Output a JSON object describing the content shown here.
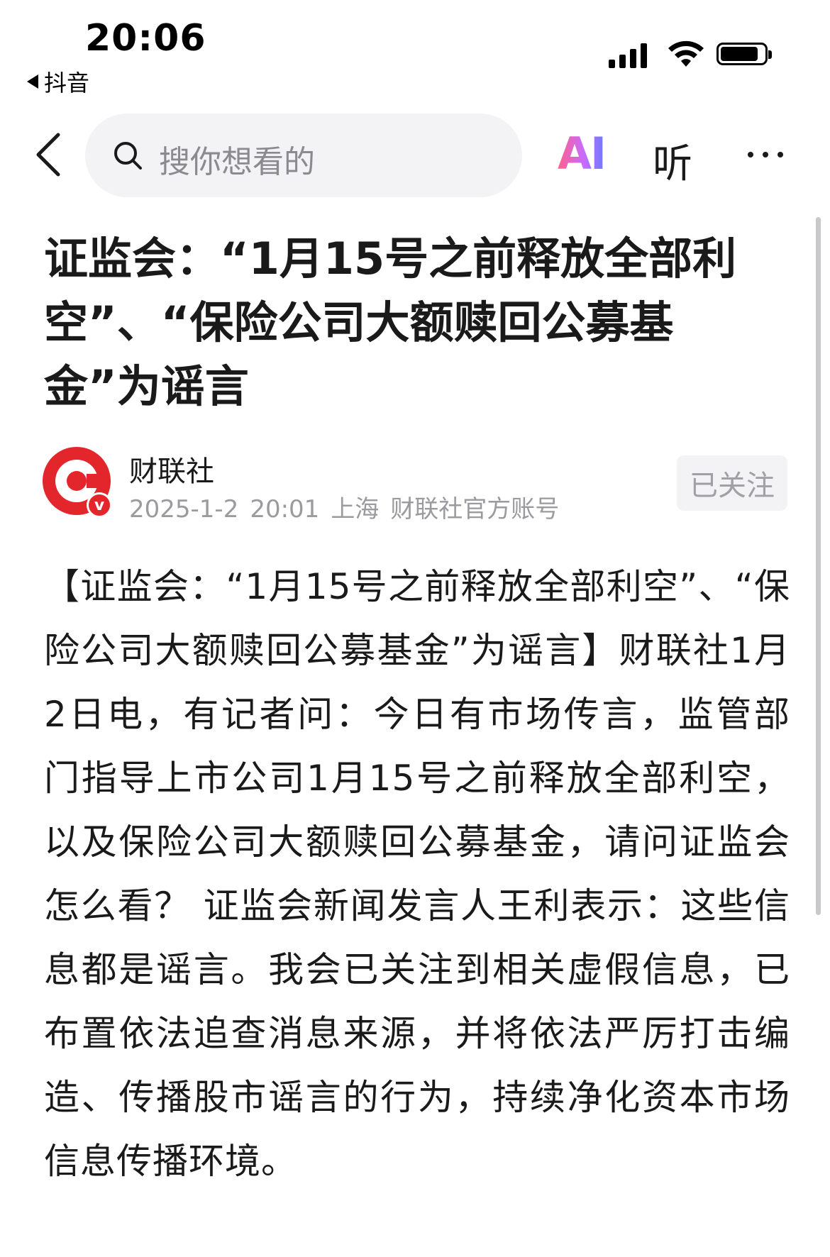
{
  "status_bar": {
    "time": "20:06",
    "back_app_label": "抖音"
  },
  "nav": {
    "search_placeholder": "搜你想看的",
    "ai_label": "AI",
    "listen_label": "听"
  },
  "article": {
    "title": "证监会：“1月15号之前释放全部利空”、“保险公司大额赎回公募基金”为谣言",
    "author": "财联社",
    "date": "2025-1-2",
    "time": "20:01",
    "location": "上海",
    "account_type": "财联社官方账号",
    "follow_label": "已关注",
    "body": "【证监会：“1月15号之前释放全部利空”、“保险公司大额赎回公募基金”为谣言】财联社1月2日电，有记者问：今日有市场传言，监管部门指导上市公司1月15号之前释放全部利空，以及保险公司大额赎回公募基金，请问证监会怎么看？ 证监会新闻发言人王利表示：这些信息都是谣言。我会已关注到相关虚假信息，已布置依法追查消息来源，并将依法严厉打击编造、传播股市谣言的行为，持续净化资本市场信息传播环境。"
  },
  "colors": {
    "brand_red": "#e3262c",
    "meta_gray": "#9a9a9f",
    "search_bg": "#f3f3f5"
  },
  "icons": {
    "back": "chevron-left-icon",
    "search": "search-icon",
    "ai": "ai-icon",
    "more": "more-icon"
  }
}
